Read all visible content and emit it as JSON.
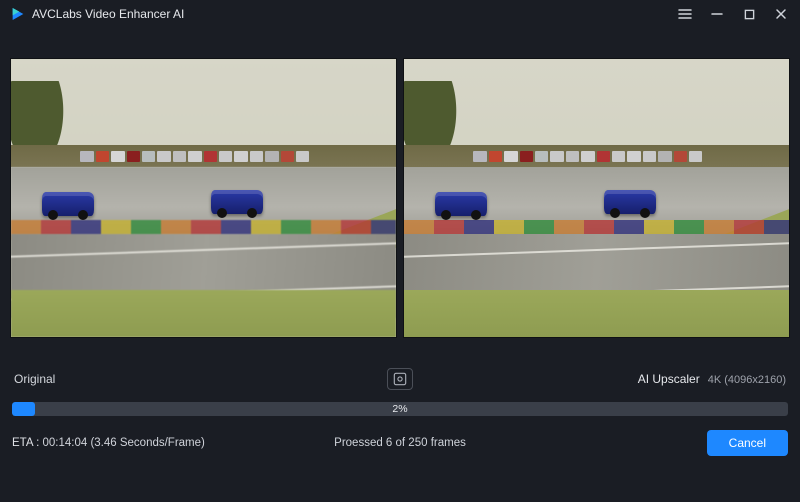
{
  "app": {
    "title": "AVCLabs Video Enhancer AI"
  },
  "preview": {
    "left_label": "Original",
    "right_label": "AI Upscaler",
    "right_resolution": "4K (4096x2160)"
  },
  "progress": {
    "percent_text": "2%",
    "fill_width": "3%"
  },
  "status": {
    "eta_label": "ETA :",
    "eta_value": "00:14:04 (3.46 Seconds/Frame)",
    "processed": "Proessed 6 of 250 frames"
  },
  "actions": {
    "cancel": "Cancel"
  }
}
